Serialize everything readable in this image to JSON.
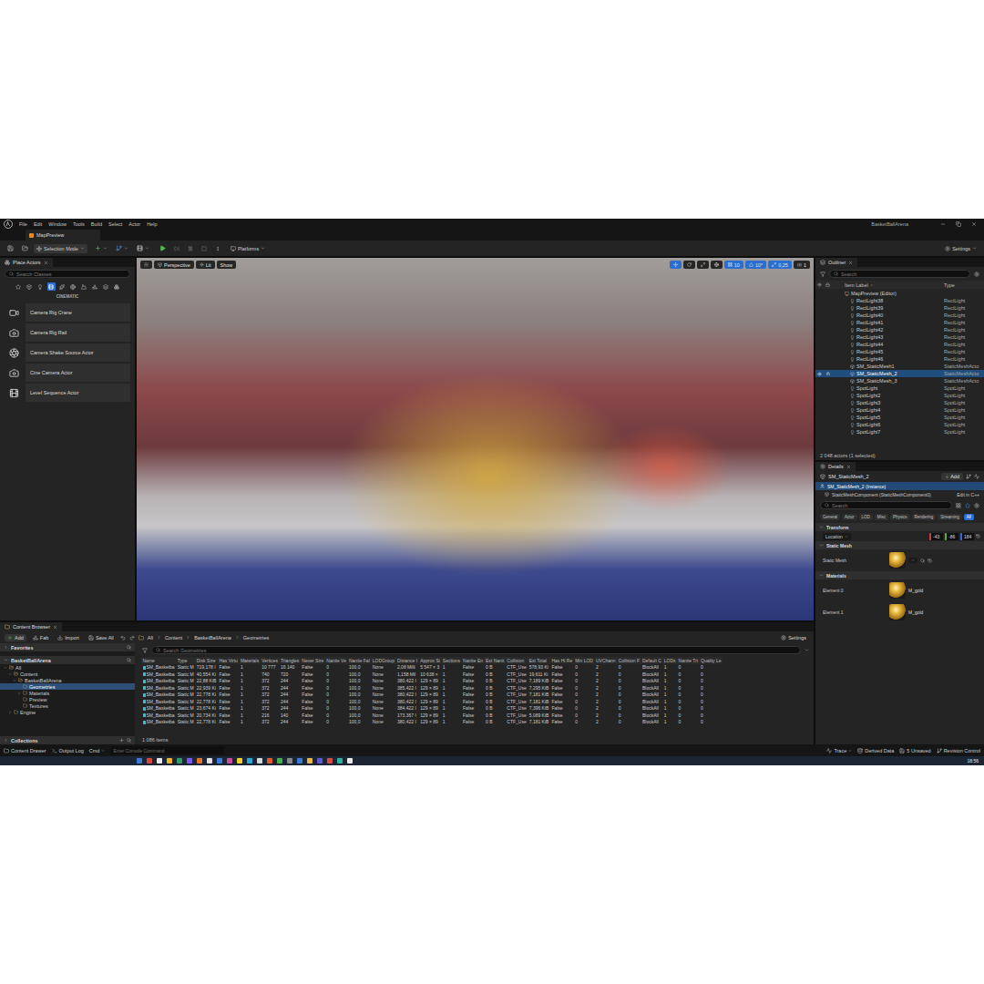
{
  "window": {
    "title": "BasketBallArena",
    "menus": [
      "File",
      "Edit",
      "Window",
      "Tools",
      "Build",
      "Select",
      "Actor",
      "Help"
    ]
  },
  "level_tab": {
    "label": "MapPreview",
    "selected": true
  },
  "toolbar": {
    "mode": "Selection Mode",
    "platforms": "Platforms",
    "settings": "Settings"
  },
  "place_actors": {
    "title": "Place Actors",
    "search": {
      "placeholder": "Search Classes"
    },
    "category_tabs": [
      {
        "selected": false
      },
      {
        "selected": false
      },
      {
        "selected": false
      },
      {
        "selected": true
      },
      {
        "selected": false
      },
      {
        "selected": false
      },
      {
        "selected": false
      },
      {
        "selected": false
      },
      {
        "selected": false
      },
      {
        "selected": false
      }
    ],
    "category": "CINEMATIC",
    "items": [
      "Camera Rig Crane",
      "Camera Rig Rail",
      "Camera Shake Source Actor",
      "Cine Camera Actor",
      "Level Sequence Actor"
    ]
  },
  "viewport": {
    "view": "Perspective",
    "lighting": "Lit",
    "show": "Show",
    "transform_tools": [
      {
        "selected": true
      },
      {
        "selected": false
      },
      {
        "selected": false
      },
      {
        "selected": false
      }
    ],
    "grid_snap": "10",
    "rotation_snap": "10°",
    "scale_snap": "0,25",
    "camera_speed": "1"
  },
  "outliner": {
    "title": "Outliner",
    "search": {
      "placeholder": "Search"
    },
    "columns": [
      "Item Label",
      "Type"
    ],
    "rows": [
      {
        "label": "MapPreview (Editor)",
        "kind": "level",
        "selected": false
      },
      {
        "label": "RectLight38",
        "type": "RectLight",
        "kind": "rect",
        "selected": false
      },
      {
        "label": "RectLight39",
        "type": "RectLight",
        "kind": "rect",
        "selected": false
      },
      {
        "label": "RectLight40",
        "type": "RectLight",
        "kind": "rect",
        "selected": false
      },
      {
        "label": "RectLight41",
        "type": "RectLight",
        "kind": "rect",
        "selected": false
      },
      {
        "label": "RectLight42",
        "type": "RectLight",
        "kind": "rect",
        "selected": false
      },
      {
        "label": "RectLight43",
        "type": "RectLight",
        "kind": "rect",
        "selected": false
      },
      {
        "label": "RectLight44",
        "type": "RectLight",
        "kind": "rect",
        "selected": false
      },
      {
        "label": "RectLight45",
        "type": "RectLight",
        "kind": "rect",
        "selected": false
      },
      {
        "label": "RectLight46",
        "type": "RectLight",
        "kind": "rect",
        "selected": false
      },
      {
        "label": "SM_StaticMesh1",
        "type": "StaticMeshActo",
        "kind": "mesh",
        "selected": false
      },
      {
        "label": "SM_StaticMesh_2",
        "type": "StaticMeshActo",
        "kind": "mesh",
        "selected": true
      },
      {
        "label": "SM_StaticMesh_3",
        "type": "StaticMeshActo",
        "kind": "mesh",
        "selected": false
      },
      {
        "label": "SpotLight",
        "type": "SpotLight",
        "kind": "spot",
        "selected": false
      },
      {
        "label": "SpotLight2",
        "type": "SpotLight",
        "kind": "spot",
        "selected": false
      },
      {
        "label": "SpotLight3",
        "type": "SpotLight",
        "kind": "spot",
        "selected": false
      },
      {
        "label": "SpotLight4",
        "type": "SpotLight",
        "kind": "spot",
        "selected": false
      },
      {
        "label": "SpotLight5",
        "type": "SpotLight",
        "kind": "spot",
        "selected": false
      },
      {
        "label": "SpotLight6",
        "type": "SpotLight",
        "kind": "spot",
        "selected": false
      },
      {
        "label": "SpotLight7",
        "type": "SpotLight",
        "kind": "spot",
        "selected": false
      }
    ],
    "count": "2 048 actors (1 selected)"
  },
  "details": {
    "title": "Details",
    "actor": "SM_StaticMesh_2",
    "add": "Add",
    "components": [
      {
        "label": "SM_StaticMesh_2 (Instance)",
        "selected": true
      },
      {
        "label": "StaticMeshComponent (StaticMeshComponent0)",
        "selected": false
      }
    ],
    "edit_link": "Edit in C++",
    "search": {
      "placeholder": "Search"
    },
    "filters": [
      {
        "label": "General",
        "selected": false
      },
      {
        "label": "Actor",
        "selected": false
      },
      {
        "label": "LOD",
        "selected": false
      },
      {
        "label": "Misc",
        "selected": false
      },
      {
        "label": "Physics",
        "selected": false
      },
      {
        "label": "Rendering",
        "selected": false
      },
      {
        "label": "Streaming",
        "selected": false
      },
      {
        "label": "All",
        "selected": true
      }
    ],
    "transform": {
      "title": "Transform",
      "property": "Location",
      "values": [
        {
          "value": "-43",
          "color": "#c8403a"
        },
        {
          "value": "-86",
          "color": "#5aa83a"
        },
        {
          "value": "184",
          "color": "#3a6ad0"
        }
      ]
    },
    "static_mesh": {
      "title": "Static Mesh",
      "label": "Static Mesh"
    },
    "materials": {
      "title": "Materials",
      "elements": [
        {
          "label": "Element 0",
          "value": "M_gold"
        },
        {
          "label": "Element 1",
          "value": "M_gold"
        }
      ]
    }
  },
  "content_browser": {
    "title": "Content Browser",
    "actions": {
      "add": "Add",
      "fab": "Fab",
      "import": "Import",
      "save_all": "Save All"
    },
    "path": [
      "All",
      "Content",
      "BasketBallArena",
      "Geometries"
    ],
    "settings": "Settings",
    "favorites": "Favorites",
    "project": "BasketBallArena",
    "tree": [
      {
        "label": "All",
        "depth": 0,
        "has_children": true,
        "expanded": true,
        "selected": false
      },
      {
        "label": "Content",
        "depth": 1,
        "has_children": true,
        "expanded": true,
        "selected": false
      },
      {
        "label": "BasketBallArena",
        "depth": 2,
        "has_children": true,
        "expanded": true,
        "selected": false
      },
      {
        "label": "Geometries",
        "depth": 3,
        "has_children": false,
        "expanded": false,
        "selected": true
      },
      {
        "label": "Materials",
        "depth": 3,
        "has_children": true,
        "expanded": false,
        "selected": false
      },
      {
        "label": "Preview",
        "depth": 3,
        "has_children": false,
        "expanded": false,
        "selected": false
      },
      {
        "label": "Textures",
        "depth": 3,
        "has_children": false,
        "expanded": false,
        "selected": false
      },
      {
        "label": "Engine",
        "depth": 1,
        "has_children": true,
        "expanded": false,
        "selected": false
      }
    ],
    "collections": "Collections",
    "search": {
      "placeholder": "Search Geometries"
    },
    "table": {
      "columns": [
        "Name",
        "Type",
        "Disk Size",
        "Has Virtu",
        "Materials",
        "Vertices",
        "Triangles",
        "Never Stre",
        "Nanite Ve",
        "Nanite Fal",
        "LODGroup",
        "Distance I",
        "Approx Si",
        "Sections",
        "Nanite En",
        "Est Nanit",
        "Collision",
        "Est Total",
        "Has Hi Re",
        "Min LOD",
        "UVChann",
        "Collision F",
        "Default C",
        "LODs",
        "Nanite Tri",
        "Quality Le"
      ],
      "rows": [
        [
          "SM_Basketba",
          "Static M",
          "719,178 I",
          "False",
          "1",
          "10 777",
          "16 140",
          "False",
          "0",
          "100,0",
          "None",
          "2,08 Milli",
          "5 547 × 3",
          "1",
          "False",
          "0 B",
          "CTF_Use",
          "578,93 Ki",
          "False",
          "0",
          "2",
          "0",
          "BlockAll",
          "1",
          "0",
          "0"
        ],
        [
          "SM_Basketba",
          "Static M",
          "40,554 Ki",
          "False",
          "1",
          "740",
          "720",
          "False",
          "0",
          "100,0",
          "None",
          "1,158 Mil",
          "10 638 ×",
          "1",
          "False",
          "0 B",
          "CTF_Use",
          "19,611 Ki",
          "False",
          "0",
          "2",
          "0",
          "BlockAll",
          "1",
          "0",
          "0"
        ],
        [
          "SM_Basketba",
          "Static M",
          "22,88 KiB",
          "False",
          "1",
          "372",
          "244",
          "False",
          "0",
          "100,0",
          "None",
          "380,422 I",
          "129 × 89",
          "1",
          "False",
          "0 B",
          "CTF_Use",
          "7,189 KiB",
          "False",
          "0",
          "2",
          "0",
          "BlockAll",
          "1",
          "0",
          "0"
        ],
        [
          "SM_Basketba",
          "Static M",
          "22,939 Ki",
          "False",
          "1",
          "372",
          "244",
          "False",
          "0",
          "100,0",
          "None",
          "385,422 I",
          "129 × 89",
          "1",
          "False",
          "0 B",
          "CTF_Use",
          "7,295 KiB",
          "False",
          "0",
          "2",
          "0",
          "BlockAll",
          "1",
          "0",
          "0"
        ],
        [
          "SM_Basketba",
          "Static M",
          "22,778 Ki",
          "False",
          "1",
          "372",
          "244",
          "False",
          "0",
          "100,0",
          "None",
          "380,422 I",
          "129 × 89",
          "1",
          "False",
          "0 B",
          "CTF_Use",
          "7,181 KiB",
          "False",
          "0",
          "2",
          "0",
          "BlockAll",
          "1",
          "0",
          "0"
        ],
        [
          "SM_Basketba",
          "Static M",
          "22,778 Ki",
          "False",
          "1",
          "372",
          "244",
          "False",
          "0",
          "100,0",
          "None",
          "380,422 I",
          "129 × 89",
          "1",
          "False",
          "0 B",
          "CTF_Use",
          "7,181 KiB",
          "False",
          "0",
          "2",
          "0",
          "BlockAll",
          "1",
          "0",
          "0"
        ],
        [
          "SM_Basketba",
          "Static M",
          "23,674 Ki",
          "False",
          "1",
          "372",
          "244",
          "False",
          "0",
          "100,0",
          "None",
          "384,422 I",
          "129 × 89",
          "1",
          "False",
          "0 B",
          "CTF_Use",
          "7,396 KiB",
          "False",
          "0",
          "2",
          "0",
          "BlockAll",
          "1",
          "0",
          "0"
        ],
        [
          "SM_Basketba",
          "Static M",
          "20,734 Ki",
          "False",
          "1",
          "216",
          "140",
          "False",
          "0",
          "100,0",
          "None",
          "173,367 I",
          "129 × 89",
          "1",
          "False",
          "0 B",
          "CTF_Use",
          "5,089 KiB",
          "False",
          "0",
          "2",
          "0",
          "BlockAll",
          "1",
          "0",
          "0"
        ],
        [
          "SM_Basketba",
          "Static M",
          "22,778 Ki",
          "False",
          "1",
          "372",
          "244",
          "False",
          "0",
          "100,0",
          "None",
          "380,422 I",
          "129 × 89",
          "1",
          "False",
          "0 B",
          "CTF_Use",
          "7,181 KiB",
          "False",
          "0",
          "2",
          "0",
          "BlockAll",
          "1",
          "0",
          "0"
        ]
      ]
    },
    "count": "1 086 items"
  },
  "status_bar": {
    "content_drawer": "Content Drawer",
    "output_log": "Output Log",
    "cmd": "Cmd",
    "console": {
      "placeholder": "Enter Console Command"
    },
    "trace": "Trace",
    "derived_data": "Derived Data",
    "unsaved": "5 Unsaved",
    "revision_control": "Revision Control"
  },
  "taskbar": {
    "clock": "18:56",
    "apps": [
      {
        "color": "#3b78d8"
      },
      {
        "color": "#d8463b"
      },
      {
        "color": "#e8e8e8"
      },
      {
        "color": "#f0b429"
      },
      {
        "color": "#2f9e6a"
      },
      {
        "color": "#7a5af0"
      },
      {
        "color": "#e8742a"
      },
      {
        "color": "#e0e0e0"
      },
      {
        "color": "#3b78d8"
      },
      {
        "color": "#c84b9e"
      },
      {
        "color": "#f0d030"
      },
      {
        "color": "#2aa8d8"
      },
      {
        "color": "#d8d8d8"
      },
      {
        "color": "#e05a2a"
      },
      {
        "color": "#46b04a"
      },
      {
        "color": "#8a8a8a"
      },
      {
        "color": "#3b78d8"
      },
      {
        "color": "#e8b84a"
      },
      {
        "color": "#5a5ad8"
      },
      {
        "color": "#d84a4a"
      },
      {
        "color": "#2fb0a0"
      },
      {
        "color": "#e8e8e8"
      }
    ]
  }
}
